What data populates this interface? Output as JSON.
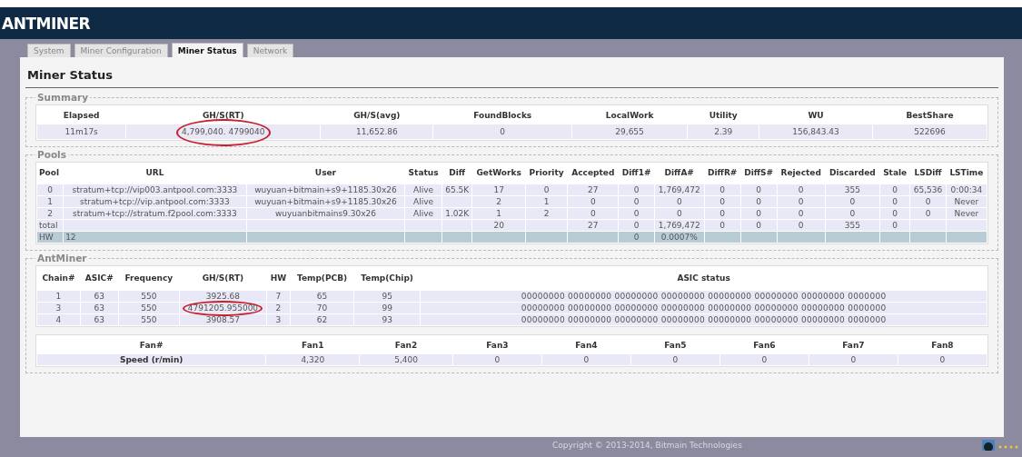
{
  "header": {
    "logo": "ANTMINER"
  },
  "tabs": [
    {
      "label": "System",
      "selected": false
    },
    {
      "label": "Miner Configuration",
      "selected": false
    },
    {
      "label": "Miner Status",
      "selected": true
    },
    {
      "label": "Network",
      "selected": false
    }
  ],
  "page_title": "Miner Status",
  "summary": {
    "legend": "Summary",
    "columns": [
      "Elapsed",
      "GH/S(RT)",
      "GH/S(avg)",
      "FoundBlocks",
      "LocalWork",
      "Utility",
      "WU",
      "BestShare"
    ],
    "values": [
      {
        "text": "11m17s",
        "circled": false
      },
      {
        "text": "4,799,040. 4799040",
        "circled": true
      },
      {
        "text": "11,652.86",
        "circled": false
      },
      {
        "text": "0",
        "circled": false
      },
      {
        "text": "29,655",
        "circled": false
      },
      {
        "text": "2.39",
        "circled": false
      },
      {
        "text": "156,843.43",
        "circled": false
      },
      {
        "text": "522696",
        "circled": false
      }
    ]
  },
  "pools": {
    "legend": "Pools",
    "columns": [
      "Pool",
      "URL",
      "User",
      "Status",
      "Diff",
      "GetWorks",
      "Priority",
      "Accepted",
      "Diff1#",
      "DiffA#",
      "DiffR#",
      "DiffS#",
      "Rejected",
      "Discarded",
      "Stale",
      "LSDiff",
      "LSTime"
    ],
    "rows": [
      {
        "kind": "data",
        "cells": [
          "0",
          "stratum+tcp://vip003.antpool.com:3333",
          "wuyuan+bitmain+s9+1185.30x26",
          "Alive",
          "65.5K",
          "17",
          "0",
          "27",
          "0",
          "1,769,472",
          "0",
          "0",
          "0",
          "355",
          "0",
          "65,536",
          "0:00:34"
        ]
      },
      {
        "kind": "data",
        "cells": [
          "1",
          "stratum+tcp://vip.antpool.com:3333",
          "wuyuan+bitmain+s9+1185.30x26",
          "Alive",
          null,
          "2",
          "1",
          "0",
          "0",
          "0",
          "0",
          "0",
          "0",
          "0",
          "0",
          "0",
          "Never"
        ]
      },
      {
        "kind": "data",
        "cells": [
          "2",
          "stratum+tcp://stratum.f2pool.com:3333",
          "wuyuanbitmains9.30x26",
          "Alive",
          "1.02K",
          "1",
          "2",
          "0",
          "0",
          "0",
          "0",
          "0",
          "0",
          "0",
          "0",
          "0",
          "Never"
        ]
      },
      {
        "kind": "total",
        "cells": [
          "total",
          null,
          null,
          null,
          null,
          "20",
          null,
          "27",
          "0",
          "1,769,472",
          "0",
          "0",
          "0",
          "355",
          "0",
          null,
          null
        ]
      },
      {
        "kind": "hw",
        "cells": [
          "HW",
          "12",
          null,
          null,
          null,
          null,
          null,
          null,
          "0",
          "0.0007%",
          null,
          null,
          null,
          null,
          null,
          null,
          null
        ]
      }
    ]
  },
  "antminer": {
    "legend": "AntMiner",
    "columns": [
      "Chain#",
      "ASIC#",
      "Frequency",
      "GH/S(RT)",
      "HW",
      "Temp(PCB)",
      "Temp(Chip)",
      "ASIC status"
    ],
    "chains": [
      {
        "cells": [
          "1",
          "63",
          "550",
          "3925.68",
          "7",
          "65",
          "95",
          "00000000 00000000 00000000 00000000 00000000 00000000 00000000 0000000"
        ],
        "circled": false
      },
      {
        "cells": [
          "3",
          "63",
          "550",
          "4791205.955000",
          "2",
          "70",
          "99",
          "00000000 00000000 00000000 00000000 00000000 00000000 00000000 0000000"
        ],
        "circled": true
      },
      {
        "cells": [
          "4",
          "63",
          "550",
          "3908.57",
          "3",
          "62",
          "93",
          "00000000 00000000 00000000 00000000 00000000 00000000 00000000 0000000"
        ],
        "circled": false
      }
    ],
    "fans": {
      "columns": [
        "Fan#",
        "Fan1",
        "Fan2",
        "Fan3",
        "Fan4",
        "Fan5",
        "Fan6",
        "Fan7",
        "Fan8"
      ],
      "values": [
        "Speed (r/min)",
        "4,320",
        "5,400",
        "0",
        "0",
        "0",
        "0",
        "0",
        "0"
      ]
    }
  },
  "footer": "Copyright © 2013-2014, Bitmain Technologies"
}
